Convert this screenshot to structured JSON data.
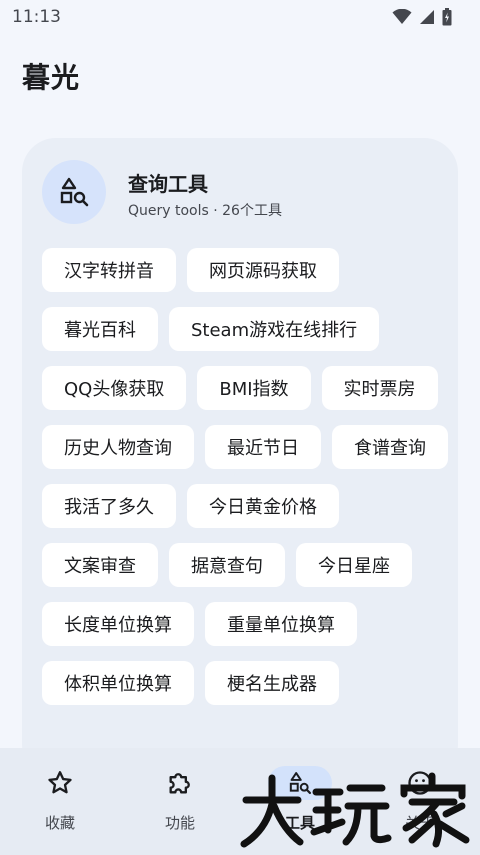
{
  "status_bar": {
    "time": "11:13",
    "icons": [
      "wifi-icon",
      "cell-signal-icon",
      "battery-icon"
    ]
  },
  "app": {
    "title": "暮光"
  },
  "card": {
    "icon": "shapes-search-icon",
    "title": "查询工具",
    "subtitle": "Query tools · 26个工具",
    "tools": [
      "汉字转拼音",
      "网页源码获取",
      "暮光百科",
      "Steam游戏在线排行",
      "QQ头像获取",
      "BMI指数",
      "实时票房",
      "历史人物查询",
      "最近节日",
      "食谱查询",
      "我活了多久",
      "今日黄金价格",
      "文案审查",
      "据意查句",
      "今日星座",
      "长度单位换算",
      "重量单位换算",
      "体积单位换算",
      "梗名生成器"
    ]
  },
  "bottom_nav": {
    "items": [
      {
        "label": "收藏",
        "icon": "star-icon",
        "active": false
      },
      {
        "label": "功能",
        "icon": "puzzle-icon",
        "active": false
      },
      {
        "label": "工具",
        "icon": "shapes-search-icon",
        "active": true
      },
      {
        "label": "关于",
        "icon": "smile-icon",
        "active": false
      }
    ]
  },
  "colors": {
    "background": "#f3f6fc",
    "card": "#e9eef6",
    "chip": "#ffffff",
    "icon_circle": "#d6e3fb",
    "nav_bar": "#e6ebf3",
    "nav_active_pill": "#d3e2fb",
    "text_primary": "#1b1c1f",
    "text_secondary": "#44474e"
  },
  "watermark": {
    "text": "大玩家"
  }
}
